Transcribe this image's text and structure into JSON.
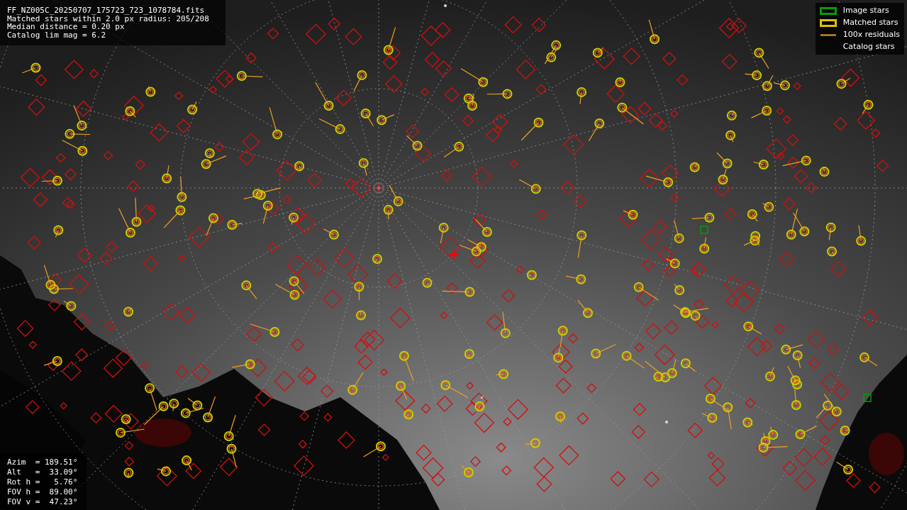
{
  "info_panel": {
    "lines": [
      "FF_NZ005C_20250707_175723_723_1078784.fits",
      "Matched stars within 2.0 px radius: 205/208",
      "Median distance = 0.20 px",
      "Catalog lim mag = 6.2"
    ]
  },
  "legend": [
    {
      "label": "Image stars",
      "kind": "box",
      "color": "#00a000"
    },
    {
      "label": "Matched stars",
      "kind": "box",
      "color": "#e0c000"
    },
    {
      "label": "100x residuals",
      "kind": "line",
      "color": "#f0a020"
    },
    {
      "label": "Catalog stars",
      "kind": "none"
    }
  ],
  "pointing_panel": {
    "lines": [
      "Azim  = 189.51°",
      "Alt   =  33.09°",
      "Rot h =   5.76°",
      "FOV h =  89.00°",
      "FOV v =  47.23°"
    ]
  }
}
